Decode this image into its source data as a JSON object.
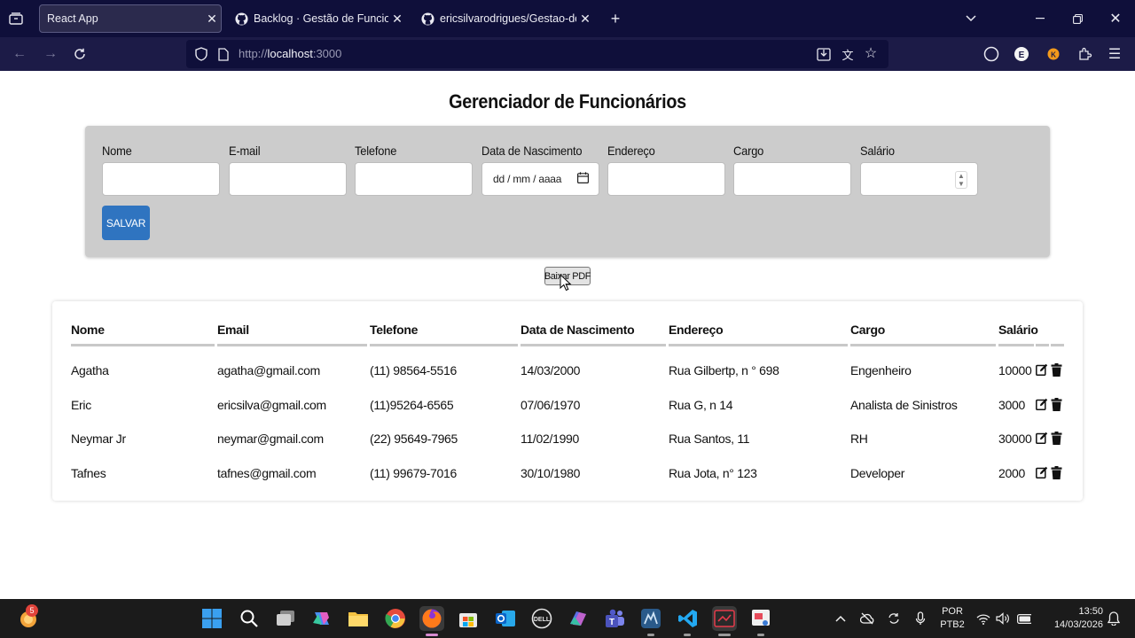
{
  "browser": {
    "tabs": [
      {
        "title": "React App",
        "active": true
      },
      {
        "title": "Backlog · Gestão de Funcionário",
        "active": false
      },
      {
        "title": "ericsilvarodrigues/Gestao-de-Fu",
        "active": false
      }
    ],
    "url_prefix": "http://",
    "url_host": "localhost",
    "url_port": ":3000"
  },
  "page": {
    "title": "Gerenciador de Funcionários",
    "form": {
      "fields": [
        {
          "label": "Nome",
          "value": ""
        },
        {
          "label": "E-mail",
          "value": ""
        },
        {
          "label": "Telefone",
          "value": ""
        },
        {
          "label": "Data de Nascimento",
          "placeholder": "dd / mm / aaaa"
        },
        {
          "label": "Endereço",
          "value": ""
        },
        {
          "label": "Cargo",
          "value": ""
        },
        {
          "label": "Salário",
          "value": ""
        }
      ],
      "save_label": "SALVAR"
    },
    "pdf_label": "Baixar PDF",
    "table": {
      "headers": [
        "Nome",
        "Email",
        "Telefone",
        "Data de Nascimento",
        "Endereço",
        "Cargo",
        "Salário"
      ],
      "rows": [
        [
          "Agatha",
          "agatha@gmail.com",
          "(11) 98564-5516",
          "14/03/2000",
          "Rua Gilbertp, n ° 698",
          "Engenheiro",
          "10000"
        ],
        [
          "Eric",
          "ericsilva@gmail.com",
          "(11)95264-6565",
          "07/06/1970",
          "Rua G, n 14",
          "Analista de Sinistros",
          "3000"
        ],
        [
          "Neymar Jr",
          "neymar@gmail.com",
          "(22) 95649-7965",
          "11/02/1990",
          "Rua Santos, 11",
          "RH",
          "30000"
        ],
        [
          "Tafnes",
          "tafnes@gmail.com",
          "(11) 99679-7016",
          "30/10/1980",
          "Rua Jota, n° 123",
          "Developer",
          "2000"
        ]
      ]
    }
  },
  "taskbar": {
    "notification_badge": "5",
    "language": "POR",
    "keyboard": "PTB2",
    "time": "13:50",
    "date": "14/03/2026"
  },
  "colors": {
    "tabbar": "#0f0f3a",
    "navbar": "#1c1b47",
    "form_panel": "#cccccc",
    "save_button": "#2f74c0",
    "taskbar": "#1b1b1b"
  }
}
